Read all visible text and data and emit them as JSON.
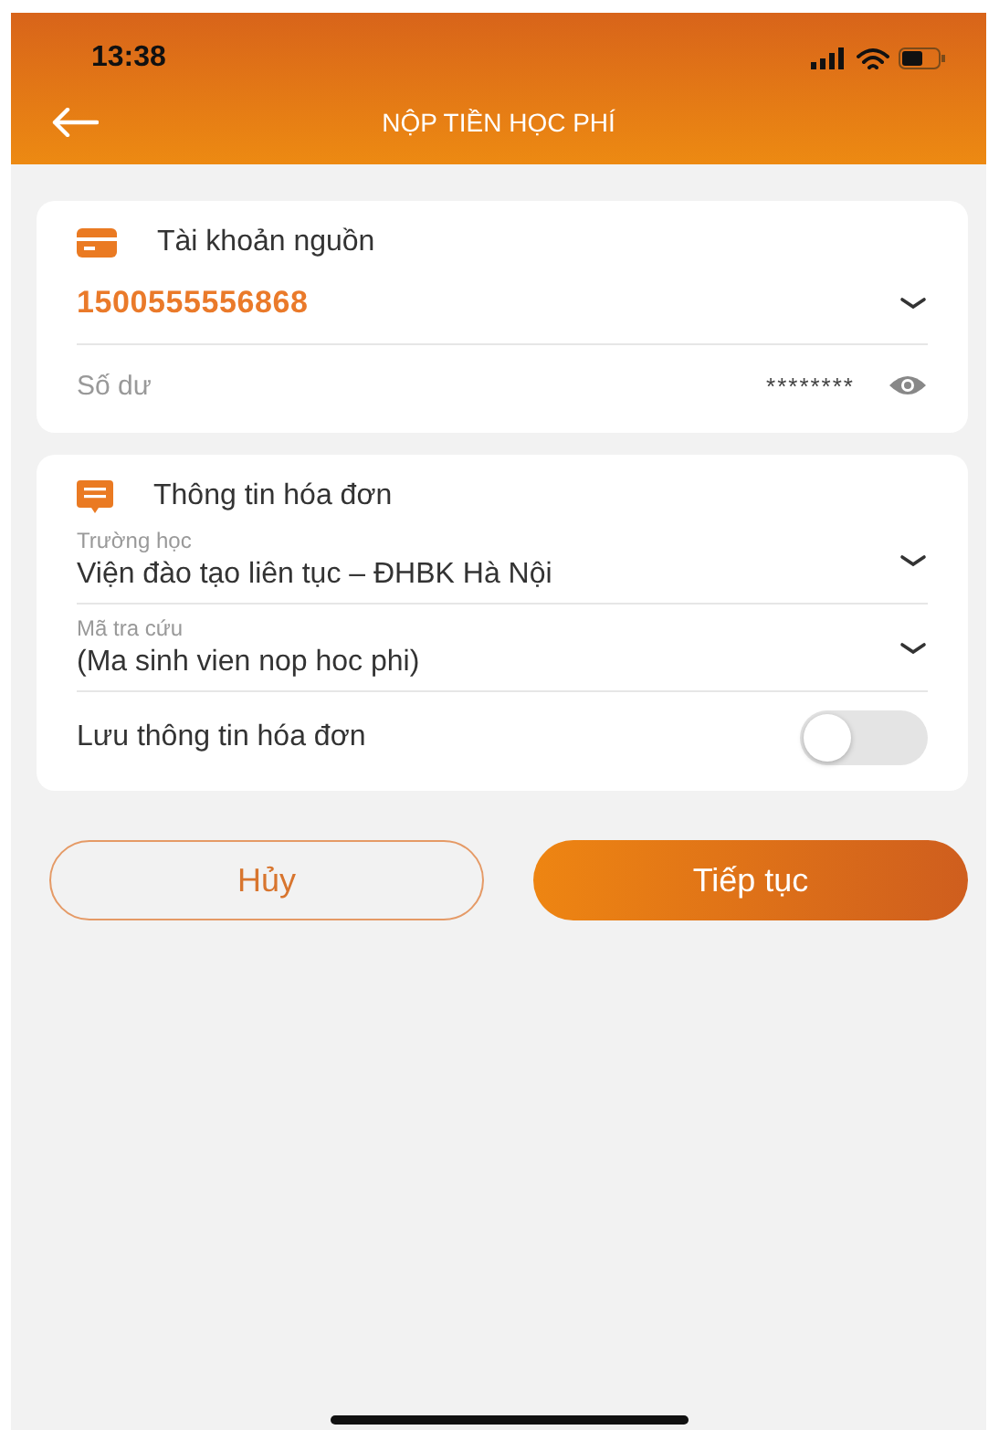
{
  "status_bar": {
    "time": "13:38"
  },
  "header": {
    "title": "NỘP TIỀN HỌC PHÍ"
  },
  "source_account": {
    "title": "Tài khoản nguồn",
    "account_number": "1500555556868",
    "balance_label": "Số dư",
    "balance_value": "********"
  },
  "invoice": {
    "title": "Thông tin hóa đơn",
    "fields": [
      {
        "label": "Trường học",
        "value": "Viện đào tạo liên tục – ĐHBK Hà Nội"
      },
      {
        "label": "Mã tra cứu",
        "value": "(Ma sinh vien nop hoc phi)"
      }
    ],
    "save": {
      "label": "Lưu thông tin hóa đơn",
      "on": false
    }
  },
  "buttons": [
    {
      "label": "Hủy",
      "kind": "secondary"
    },
    {
      "label": "Tiếp tục",
      "kind": "primary"
    }
  ]
}
